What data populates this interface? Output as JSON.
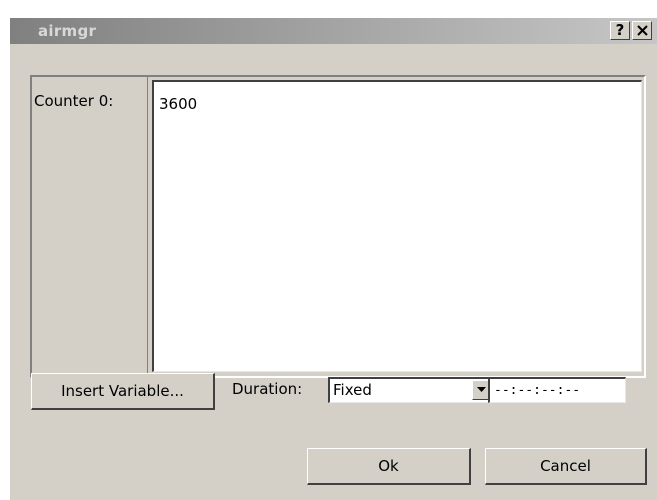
{
  "window": {
    "title": "airmgr",
    "help_label": "?",
    "close_label": "×"
  },
  "counter": {
    "label": "Counter 0:",
    "value": "3600"
  },
  "controls": {
    "insert_label": "Insert Variable...",
    "duration_label": "Duration:",
    "duration_value": "Fixed",
    "time_value": "--:--:--:--"
  },
  "buttons": {
    "ok_label": "Ok",
    "cancel_label": "Cancel"
  }
}
